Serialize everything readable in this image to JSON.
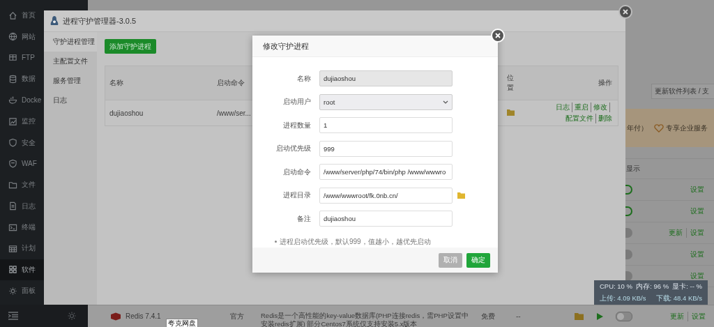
{
  "sidebar": {
    "items": [
      {
        "label": "首页",
        "selected": false
      },
      {
        "label": "网站",
        "selected": false
      },
      {
        "label": "FTP",
        "selected": false
      },
      {
        "label": "数据",
        "selected": false
      },
      {
        "label": "Docke",
        "selected": false
      },
      {
        "label": "监控",
        "selected": false
      },
      {
        "label": "安全",
        "selected": false
      },
      {
        "label": "WAF",
        "selected": false
      },
      {
        "label": "文件",
        "selected": false
      },
      {
        "label": "日志",
        "selected": false
      },
      {
        "label": "终端",
        "selected": false
      },
      {
        "label": "计划",
        "selected": false
      },
      {
        "label": "软件",
        "selected": true
      },
      {
        "label": "面板",
        "selected": false
      }
    ]
  },
  "store": {
    "update_button": "更新软件列表 / 支",
    "banner": [
      "年付）",
      "专享企业服务"
    ],
    "column_header": "显示",
    "rows": [
      {
        "on": true,
        "actions": [
          "设置"
        ]
      },
      {
        "on": true,
        "actions": [
          "设置"
        ]
      },
      {
        "on": false,
        "actions": [
          "更新",
          "设置"
        ]
      },
      {
        "on": false,
        "actions": [
          "设置"
        ]
      },
      {
        "on": false,
        "actions": [
          "设置"
        ]
      }
    ]
  },
  "bottom_row": {
    "name": "Redis 7.4.1",
    "source": "官方",
    "description": "Redis是一个高性能的key-value数据库(PHP连接redis，需PHP设置中安装redis扩展) 部分Centos7系统仅支持安装5.x版本",
    "price": "免费",
    "column_5": "--",
    "on": false,
    "actions": [
      "更新",
      "设置"
    ]
  },
  "tooltip": "夸克网盘",
  "plugin_window": {
    "title": "进程守护管理器-3.0.5",
    "menu": [
      {
        "label": "守护进程管理",
        "selected": true
      },
      {
        "label": "主配置文件",
        "selected": false
      },
      {
        "label": "服务管理",
        "selected": false
      },
      {
        "label": "日志",
        "selected": false
      }
    ],
    "add_button": "添加守护进程",
    "table": {
      "columns": [
        "名称",
        "启动命令",
        "位置",
        "操作"
      ],
      "rows": [
        {
          "name": "dujiaoshou",
          "command": "/www/ser...",
          "actions": [
            "日志",
            "重启",
            "修改",
            "配置文件",
            "删除"
          ]
        }
      ]
    }
  },
  "dialog": {
    "title": "修改守护进程",
    "fields": [
      {
        "label": "名称",
        "kind": "text",
        "value": "dujiaoshou",
        "disabled": true
      },
      {
        "label": "启动用户",
        "kind": "select",
        "value": "root",
        "disabled": false
      },
      {
        "label": "进程数量",
        "kind": "text",
        "value": "1",
        "disabled": false
      },
      {
        "label": "启动优先级",
        "kind": "text",
        "value": "999",
        "disabled": false
      },
      {
        "label": "启动命令",
        "kind": "text",
        "value": "/www/server/php/74/bin/php /www/wwwro",
        "disabled": false
      },
      {
        "label": "进程目录",
        "kind": "path",
        "value": "/www/wwwroot/fk.0nb.cn/",
        "disabled": false
      },
      {
        "label": "备注",
        "kind": "text",
        "value": "dujiaoshou",
        "disabled": false
      }
    ],
    "note": "进程启动优先级，默认999，值越小，越优先启动",
    "buttons": [
      {
        "label": "取消",
        "kind": "cancel"
      },
      {
        "label": "确定",
        "kind": "primary"
      }
    ]
  },
  "monitor": {
    "cpu": "CPU: 10 %",
    "memory": "内存: 96 %",
    "gpu": "显卡: -- %",
    "upload": "上传: 4.09 KB/s",
    "download": "下载: 48.4 KB/s"
  }
}
